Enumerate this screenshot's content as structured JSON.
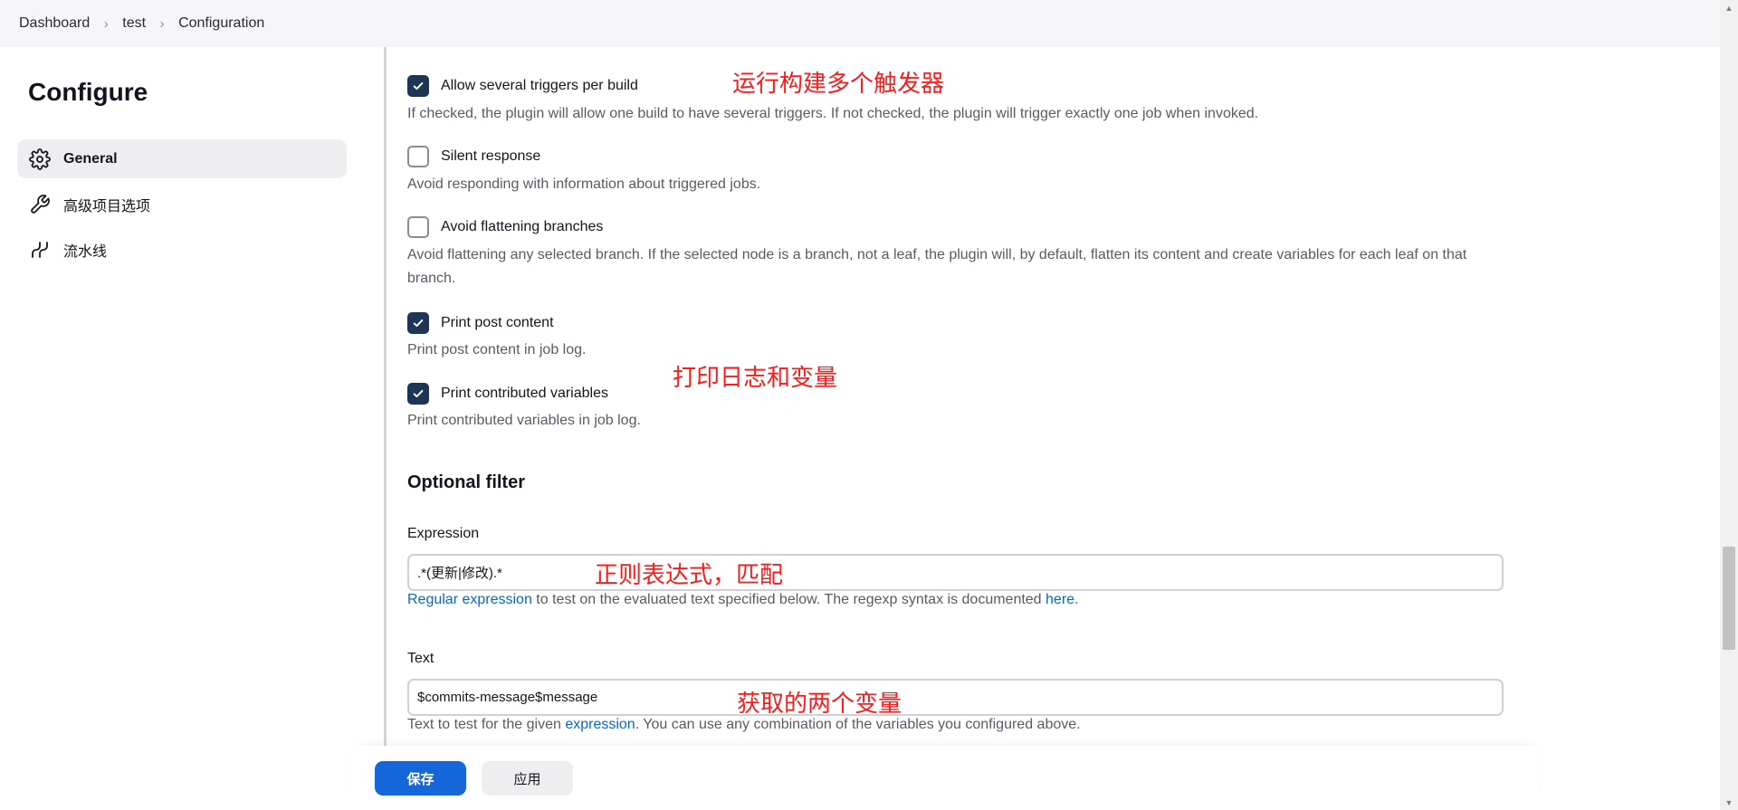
{
  "breadcrumb": {
    "items": [
      "Dashboard",
      "test",
      "Configuration"
    ],
    "separator": "›"
  },
  "sidebar": {
    "title": "Configure",
    "items": [
      {
        "label": "General",
        "icon": "gear-icon",
        "active": true
      },
      {
        "label": "高级项目选项",
        "icon": "wrench-icon",
        "active": false
      },
      {
        "label": "流水线",
        "icon": "pipeline-icon",
        "active": false
      }
    ]
  },
  "options": [
    {
      "label": "Allow several triggers per build",
      "checked": true,
      "description": "If checked, the plugin will allow one build to have several triggers. If not checked, the plugin will trigger exactly one job when invoked."
    },
    {
      "label": "Silent response",
      "checked": false,
      "description": "Avoid responding with information about triggered jobs."
    },
    {
      "label": "Avoid flattening branches",
      "checked": false,
      "description": "Avoid flattening any selected branch. If the selected node is a branch, not a leaf, the plugin will, by default, flatten its content and create variables for each leaf on that branch."
    },
    {
      "label": "Print post content",
      "checked": true,
      "description": "Print post content in job log."
    },
    {
      "label": "Print contributed variables",
      "checked": true,
      "description": "Print contributed variables in job log."
    }
  ],
  "filter": {
    "title": "Optional filter",
    "expression": {
      "label": "Expression",
      "value": ".*(更新|修改).*",
      "help_link1": "Regular expression",
      "help_mid": " to test on the evaluated text specified below. The regexp syntax is documented ",
      "help_link2": "here",
      "help_end": "."
    },
    "text": {
      "label": "Text",
      "value": "$commits-message$message",
      "help_start": "Text to test for the given ",
      "help_link": "expression",
      "help_end": ". You can use any combination of the variables you configured above."
    }
  },
  "annotations": {
    "triggers": "运行构建多个触发器",
    "print": "打印日志和变量",
    "regex": "正则表达式，匹配",
    "vars": "获取的两个变量"
  },
  "buttons": {
    "save": "保存",
    "apply": "应用"
  },
  "colors": {
    "primary": "#1466d9",
    "checkbox": "#1d3557",
    "annotation": "#ff1a1a",
    "link": "#0b67c2"
  }
}
